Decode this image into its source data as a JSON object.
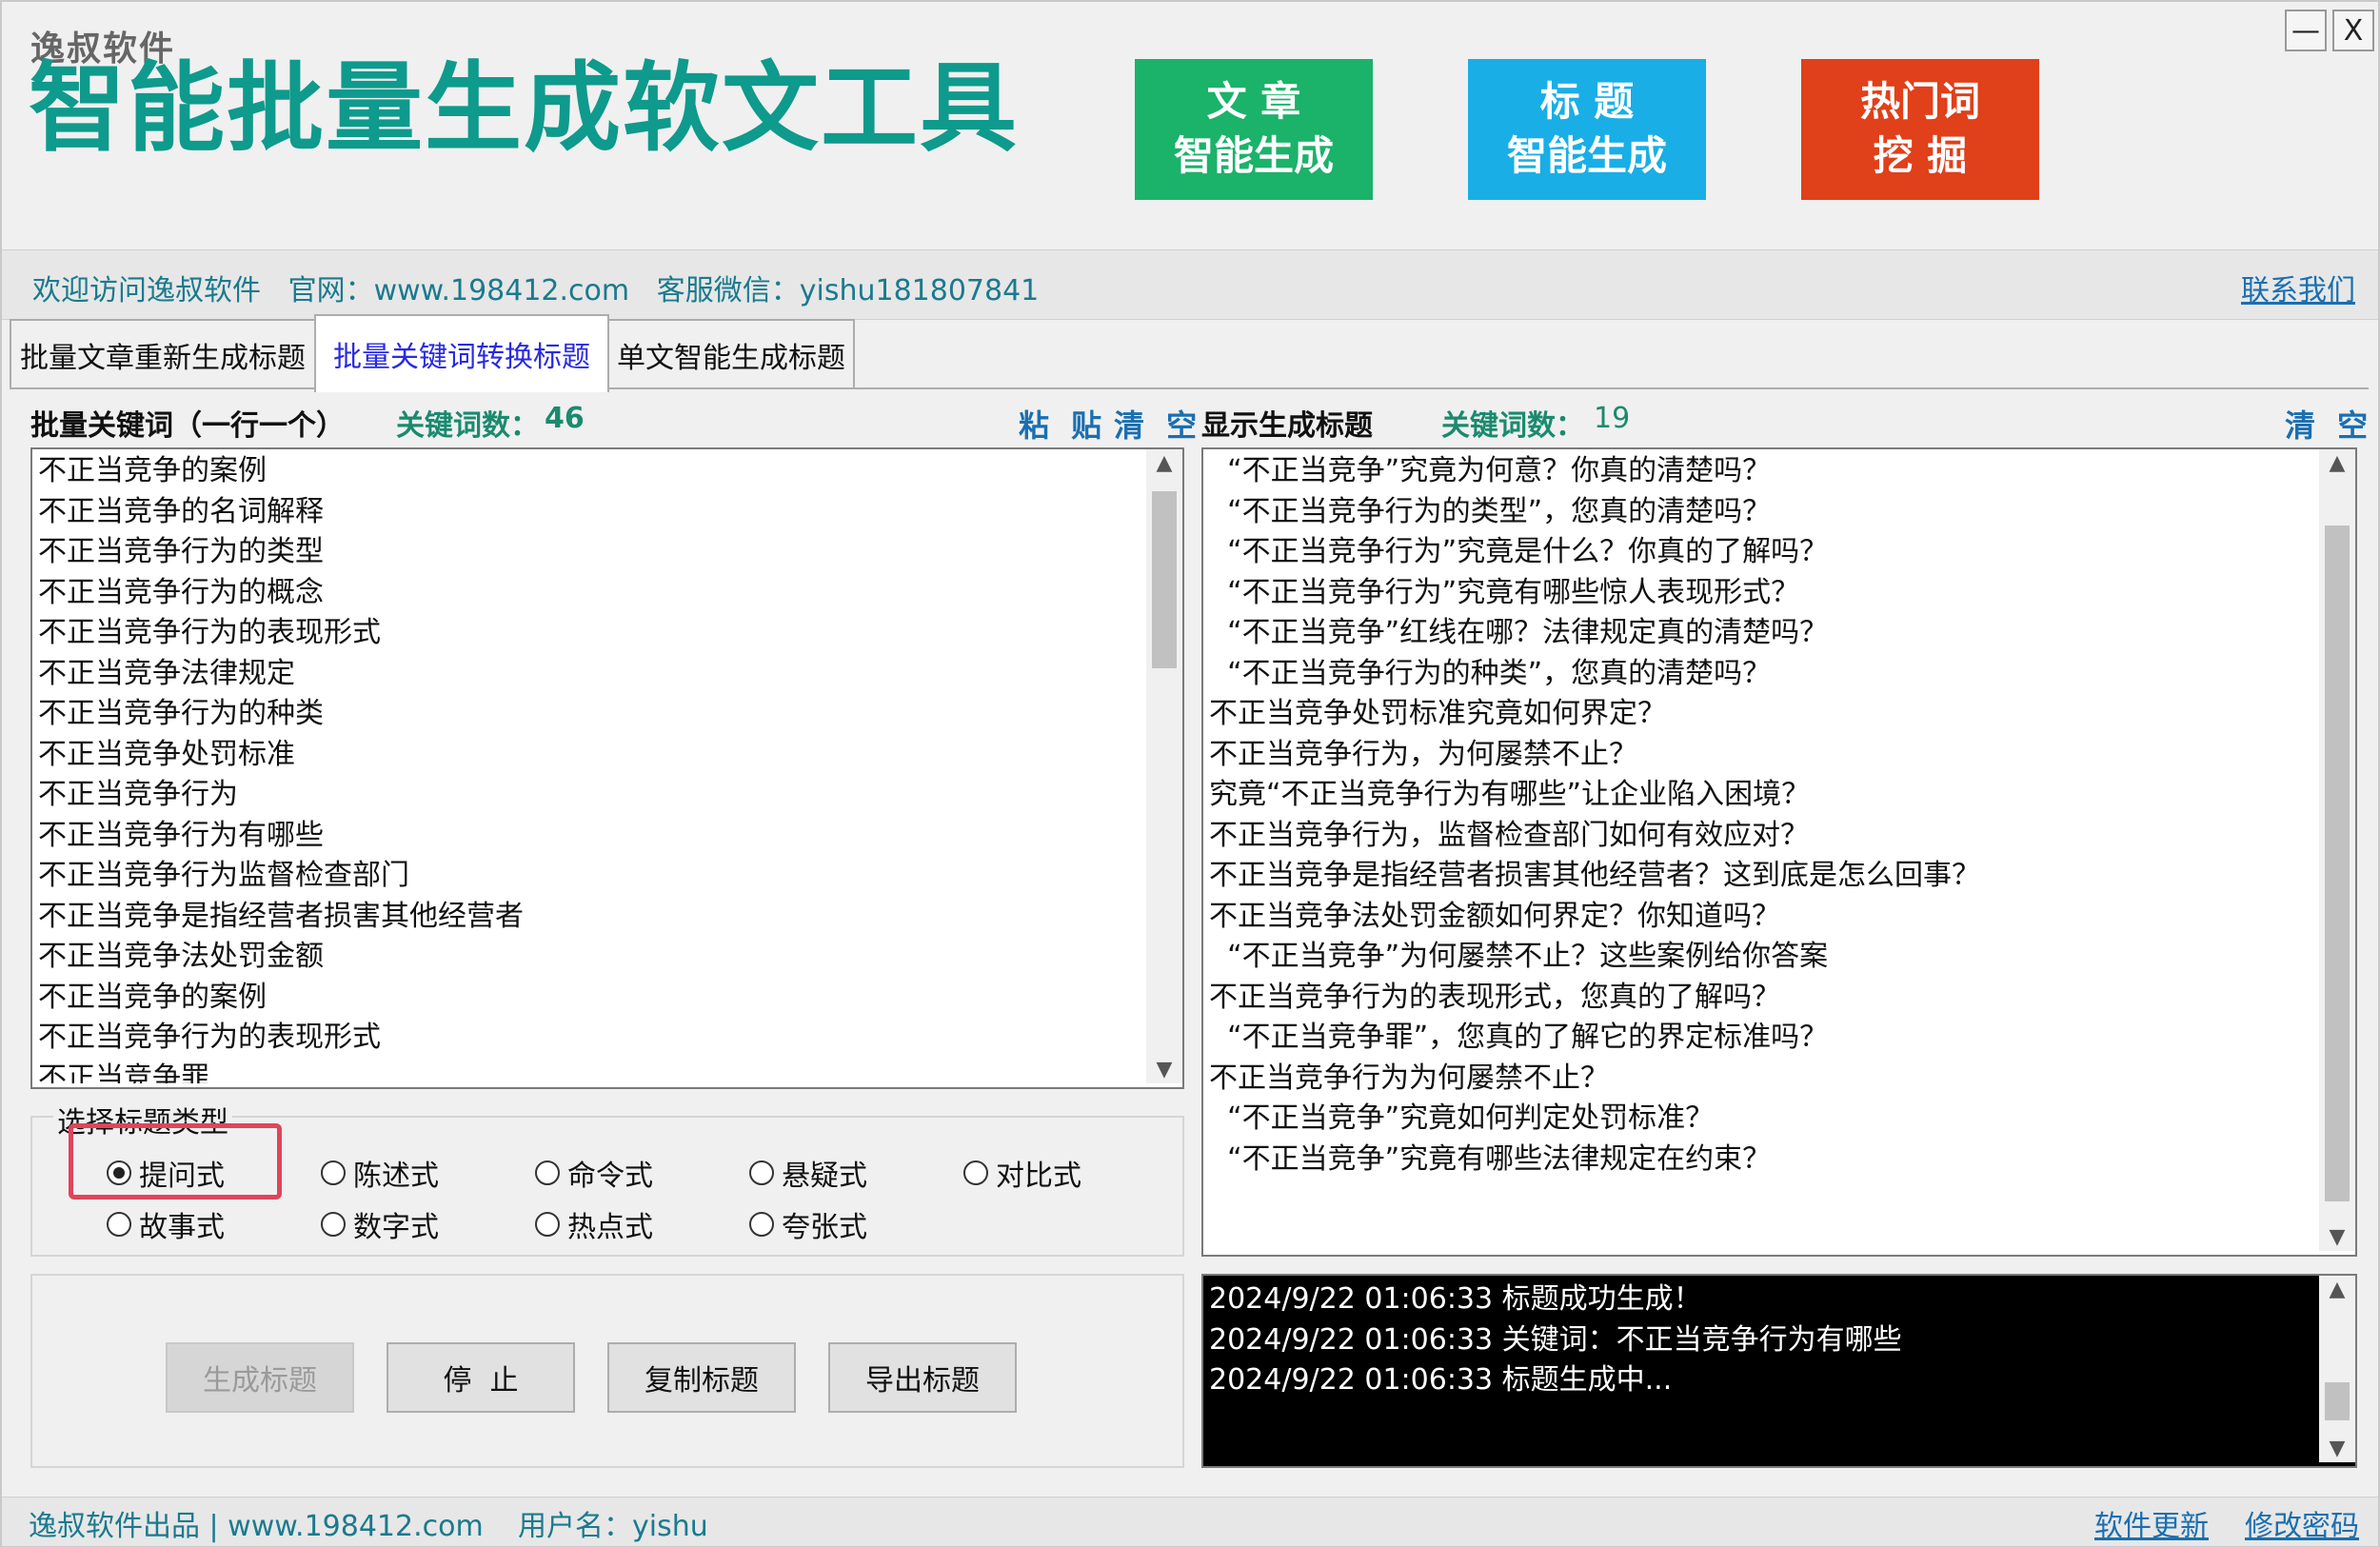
{
  "header": {
    "brand": "逸叔软件",
    "app_title": "智能批量生成软文工具",
    "buttons": [
      {
        "label": "文 章\n智能生成",
        "color": "#1bb26a"
      },
      {
        "label": "标 题\n智能生成",
        "color": "#19aee6"
      },
      {
        "label": "热门词\n挖 掘",
        "color": "#e0401a"
      }
    ],
    "minimize_label": "—",
    "close_label": "X"
  },
  "info_bar": {
    "text": "欢迎访问逸叔软件   官网：www.198412.com   客服微信：yishu181807841",
    "contact_link": "联系我们"
  },
  "tabs": [
    {
      "label": "批量文章重新生成标题",
      "active": false
    },
    {
      "label": "批量关键词转换标题",
      "active": true
    },
    {
      "label": "单文智能生成标题",
      "active": false
    }
  ],
  "left_panel": {
    "heading": "批量关键词（一行一个）",
    "count_label": "关键词数：",
    "count": "46",
    "paste_label": "粘 贴",
    "clear_label": "清 空",
    "keywords": [
      "不正当竞争的案例",
      "不正当竞争的名词解释",
      "不正当竞争行为的类型",
      "不正当竞争行为的概念",
      "不正当竞争行为的表现形式",
      "不正当竞争法律规定",
      "不正当竞争行为的种类",
      "不正当竞争处罚标准",
      "不正当竞争行为",
      "不正当竞争行为有哪些",
      "不正当竞争行为监督检查部门",
      "不正当竞争是指经营者损害其他经营者",
      "不正当竞争法处罚金额",
      "不正当竞争的案例",
      "不正当竞争行为的表现形式",
      "不正当竞争罪"
    ]
  },
  "title_type": {
    "legend": "选择标题类型",
    "options": [
      "提问式",
      "陈述式",
      "命令式",
      "悬疑式",
      "对比式",
      "故事式",
      "数字式",
      "热点式",
      "夸张式"
    ],
    "selected": "提问式"
  },
  "actions": {
    "generate": "生成标题",
    "stop": "停  止",
    "copy": "复制标题",
    "export": "导出标题"
  },
  "right_panel": {
    "heading": "显示生成标题",
    "count_label": "关键词数：",
    "count": "19",
    "clear_label": "清 空",
    "titles": [
      "  “不正当竞争”究竟为何意？你真的清楚吗？",
      "  “不正当竞争行为的类型”，您真的清楚吗？",
      "  “不正当竞争行为”究竟是什么？你真的了解吗？",
      "  “不正当竞争行为”究竟有哪些惊人表现形式？",
      "  “不正当竞争”红线在哪？法律规定真的清楚吗？",
      "  “不正当竞争行为的种类”，您真的清楚吗？",
      "不正当竞争处罚标准究竟如何界定？",
      "不正当竞争行为，为何屡禁不止？",
      "究竟“不正当竞争行为有哪些”让企业陷入困境？",
      "不正当竞争行为，监督检查部门如何有效应对？",
      "不正当竞争是指经营者损害其他经营者？这到底是怎么回事？",
      "不正当竞争法处罚金额如何界定？你知道吗？",
      "  “不正当竞争”为何屡禁不止？这些案例给你答案",
      "不正当竞争行为的表现形式，您真的了解吗？",
      "  “不正当竞争罪”，您真的了解它的界定标准吗？",
      "不正当竞争行为为何屡禁不止？",
      "  “不正当竞争”究竟如何判定处罚标准？",
      "  “不正当竞争”究竟有哪些法律规定在约束？"
    ]
  },
  "log": {
    "lines": [
      "2024/9/22 01:06:33 标题成功生成！",
      "2024/9/22 01:06:33 关键词：不正当竞争行为有哪些",
      "2024/9/22 01:06:33 标题生成中..."
    ]
  },
  "footer": {
    "left": "逸叔软件出品 | www.198412.com",
    "user": "用户名：yishu",
    "update_link": "软件更新",
    "password_link": "修改密码"
  }
}
